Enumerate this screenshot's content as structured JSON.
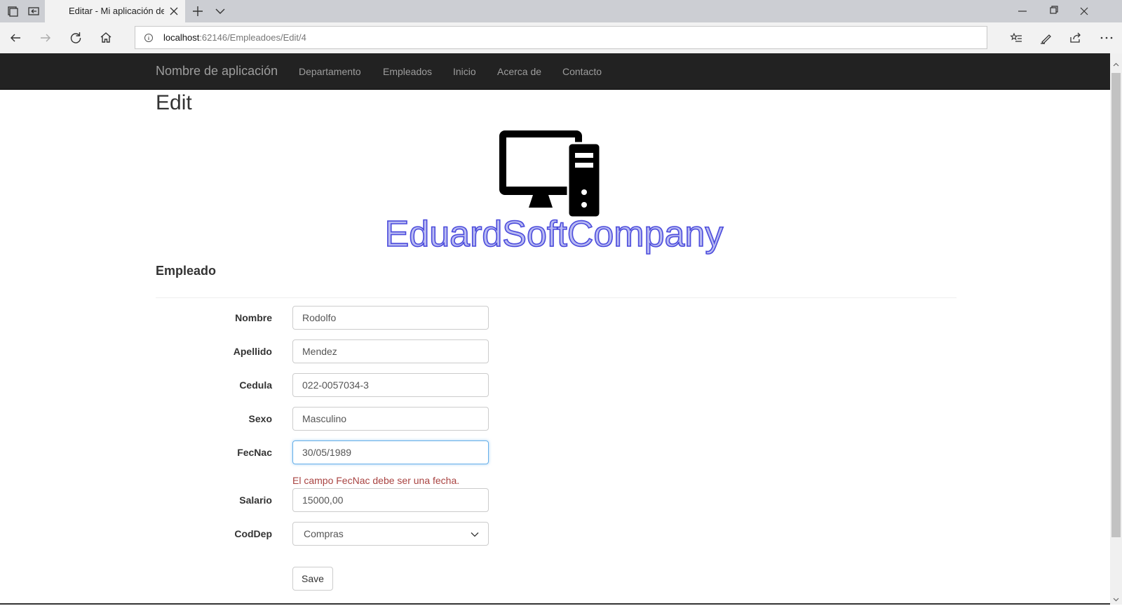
{
  "browser": {
    "tab_title": "Editar - Mi aplicación de ASP.NET",
    "url_host": "localhost",
    "url_path": ":62146/Empleadoes/Edit/4"
  },
  "site": {
    "brand": "Nombre de aplicación",
    "nav": [
      "Departamento",
      "Empleados",
      "Inicio",
      "Acerca de",
      "Contacto"
    ]
  },
  "page": {
    "title": "Edit",
    "logo_text": "EduardSoftCompany",
    "section_title": "Empleado"
  },
  "form": {
    "fields": [
      {
        "label": "Nombre",
        "value": "Rodolfo"
      },
      {
        "label": "Apellido",
        "value": "Mendez"
      },
      {
        "label": "Cedula",
        "value": "022-0057034-3"
      },
      {
        "label": "Sexo",
        "value": "Masculino"
      },
      {
        "label": "FecNac",
        "value": "30/05/1989"
      },
      {
        "label": "Salario",
        "value": "15000,00"
      },
      {
        "label": "CodDep",
        "value": "Compras"
      }
    ],
    "fecnac_error": "El campo FecNac debe ser una fecha.",
    "save_label": "Save"
  },
  "colors": {
    "navbar": "#222222",
    "nav_text": "#9d9d9d",
    "error": "#a94442",
    "focus": "#66afe9",
    "logo_fill": "#b9bbf2",
    "logo_stroke": "#4b4bdc"
  }
}
